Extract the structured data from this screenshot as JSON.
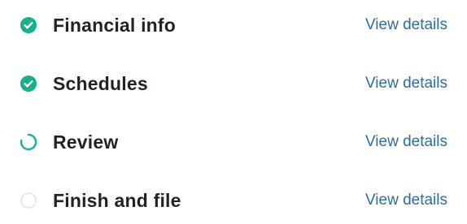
{
  "steps": [
    {
      "label": "Financial info",
      "link_label": "View details",
      "status": "complete",
      "icon": "check-circle-icon"
    },
    {
      "label": "Schedules",
      "link_label": "View details",
      "status": "complete",
      "icon": "check-circle-icon"
    },
    {
      "label": "Review",
      "link_label": "View details",
      "status": "in-progress",
      "icon": "spinner-icon"
    },
    {
      "label": "Finish and file",
      "link_label": "View details",
      "status": "not-started",
      "icon": "empty-circle-icon"
    }
  ],
  "colors": {
    "complete": "#17b08c",
    "in_progress": "#0fb2a3",
    "not_started": "#e2e4e6",
    "label": "#1f2328",
    "link": "#2c6e9c"
  }
}
